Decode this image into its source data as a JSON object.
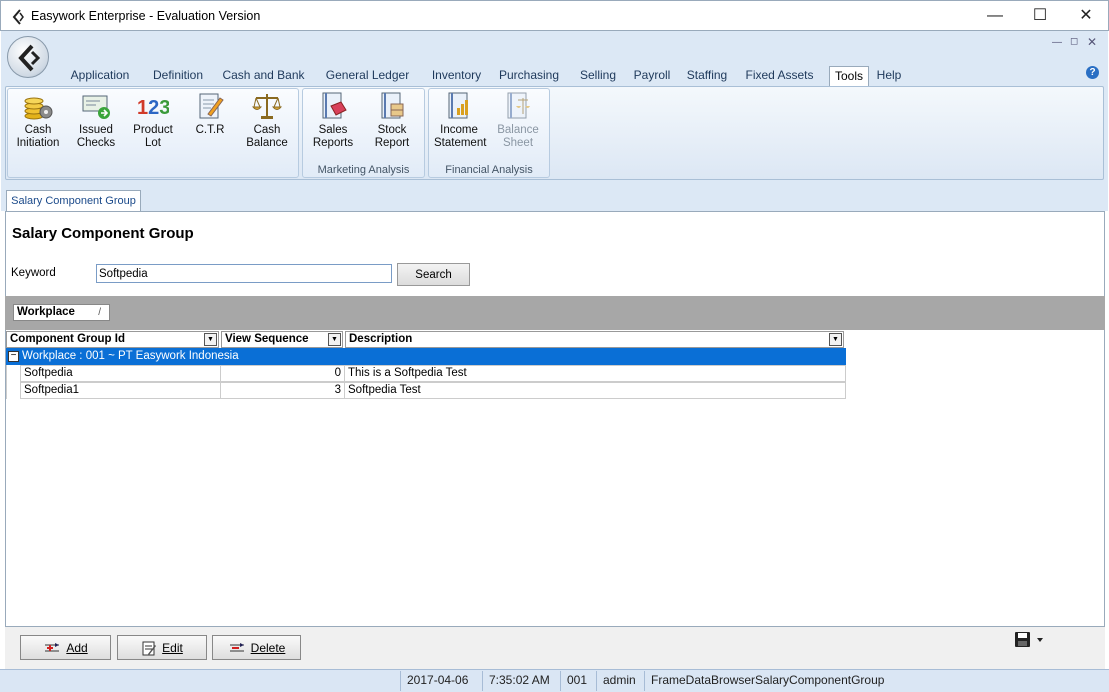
{
  "window": {
    "title": "Easywork Enterprise - Evaluation Version"
  },
  "tabs": [
    "Application",
    "Definition",
    "Cash and Bank",
    "General Ledger",
    "Inventory",
    "Purchasing",
    "Selling",
    "Payroll",
    "Staffing",
    "Fixed Assets",
    "Tools",
    "Help"
  ],
  "active_tab": "Tools",
  "ribbon": {
    "buttons": [
      {
        "label1": "Cash",
        "label2": "Initiation",
        "icon": "coins-gear-icon"
      },
      {
        "label1": "Issued",
        "label2": "Checks",
        "icon": "check-arrow-icon"
      },
      {
        "label1": "Product",
        "label2": "Lot",
        "icon": "numbers-123-icon"
      },
      {
        "label1": "C.T.R",
        "label2": "",
        "icon": "clipboard-pencil-icon"
      },
      {
        "label1": "Cash",
        "label2": "Balance",
        "icon": "scales-icon"
      },
      {
        "label1": "Sales",
        "label2": "Reports",
        "icon": "report-tag-icon"
      },
      {
        "label1": "Stock",
        "label2": "Report",
        "icon": "report-stack-icon"
      },
      {
        "label1": "Income",
        "label2": "Statement",
        "icon": "report-chart-icon"
      },
      {
        "label1": "Balance",
        "label2": "Sheet",
        "icon": "report-balance-icon",
        "disabled": true
      }
    ],
    "groups": {
      "marketing": "Marketing Analysis",
      "financial": "Financial Analysis"
    }
  },
  "doc_tab": "Salary Component Group",
  "page": {
    "heading": "Salary Component Group",
    "keyword_label": "Keyword",
    "keyword_value": "Softpedia",
    "search_label": "Search"
  },
  "grid": {
    "group_by_chip": "Workplace",
    "group_by_sep": "/",
    "columns": [
      "Component Group Id",
      "View Sequence",
      "Description"
    ],
    "group_row": "Workplace : 001 ~ PT Easywork Indonesia",
    "expander": "−",
    "rows": [
      [
        "Softpedia",
        "0",
        "This is a Softpedia Test"
      ],
      [
        "Softpedia1",
        "3",
        "Softpedia Test"
      ]
    ]
  },
  "actions": {
    "add": "Add",
    "edit": "Edit",
    "delete": "Delete"
  },
  "status": {
    "date": "2017-04-06",
    "time": "7:35:02 AM",
    "code": "001",
    "user": "admin",
    "frame": "FrameDataBrowserSalaryComponentGroup"
  },
  "colors": {
    "accent": "#0a6fd6",
    "ribbon_bg": "#dce8f5"
  }
}
